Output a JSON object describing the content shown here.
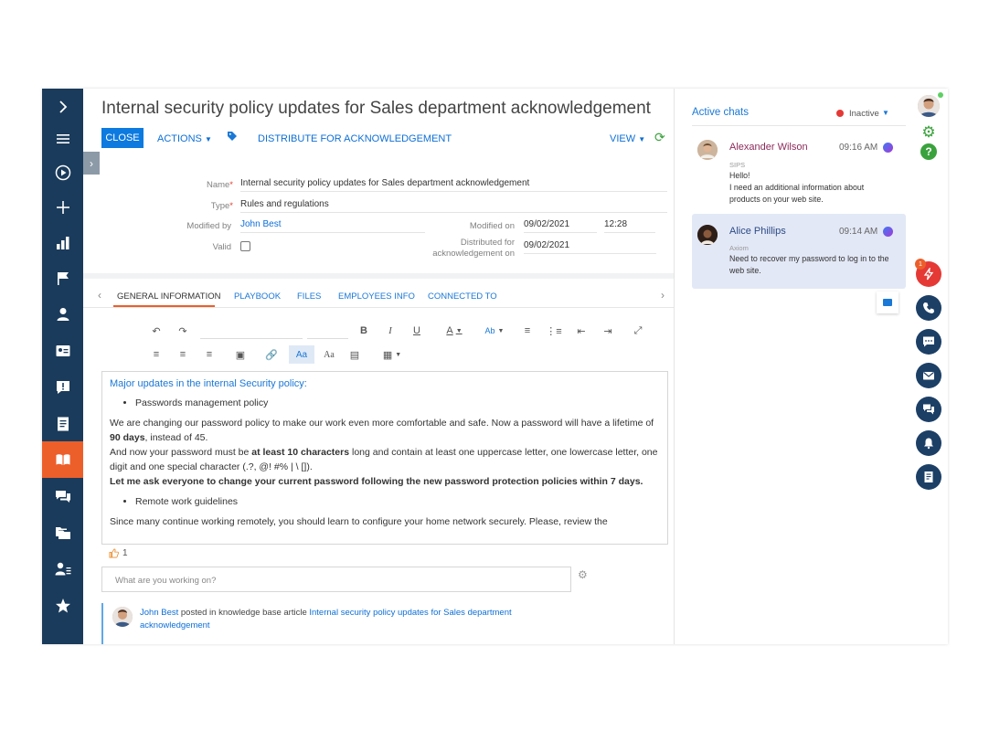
{
  "page": {
    "title": "Internal security policy updates for Sales department acknowledgement"
  },
  "toolbar": {
    "close": "CLOSE",
    "actions": "ACTIONS",
    "distribute": "DISTRIBUTE FOR ACKNOWLEDGEMENT",
    "view": "VIEW"
  },
  "fields": {
    "name_label": "Name",
    "name_value": "Internal security policy updates for Sales department acknowledgement",
    "type_label": "Type",
    "type_value": "Rules and regulations",
    "modified_by_label": "Modified by",
    "modified_by_value": "John Best",
    "valid_label": "Valid",
    "modified_on_label": "Modified on",
    "modified_on_date": "09/02/2021",
    "modified_on_time": "12:28",
    "distributed_label_1": "Distributed for",
    "distributed_label_2": "acknowledgement on",
    "distributed_value": "09/02/2021"
  },
  "tabs": [
    "GENERAL INFORMATION",
    "PLAYBOOK",
    "FILES",
    "EMPLOYEES INFO",
    "CONNECTED TO"
  ],
  "editor": {
    "heading": "Major updates in the internal Security policy:",
    "bullet1": "Passwords management policy",
    "p1_a": "We are changing our password policy to make our work even more comfortable and safe. Now a password will have a lifetime of ",
    "p1_b": "90 days",
    "p1_c": ", instead of 45.",
    "p2_a": "And now your password must be ",
    "p2_b": "at least 10 characters",
    "p2_c": " long and contain at least one uppercase letter, one lowercase letter, one digit and one special character (.?, @! #% | \\ []).",
    "p3": "Let me ask everyone to change your current password following the new password protection policies within 7 days.",
    "bullet2": "Remote work guidelines",
    "p4": "Since many continue working remotely, you should learn to configure your home network securely.  Please, review the"
  },
  "likes": "1",
  "post_placeholder": "What are you working on?",
  "feed": {
    "author": "John Best",
    "action": " posted in knowledge base article ",
    "article": "Internal security policy updates for Sales department acknowledgement"
  },
  "chats": {
    "title": "Active chats",
    "status": "Inactive",
    "items": [
      {
        "name": "Alexander Wilson",
        "time": "09:16 AM",
        "sub": "SIPS",
        "msg1": "Hello!",
        "msg2": "I need an additional information about products on your web site."
      },
      {
        "name": "Alice Phillips",
        "time": "09:14 AM",
        "sub": "Axiom",
        "msg1": "Need to recover my password to log in to the web site.",
        "msg2": ""
      }
    ]
  },
  "rightbar": {
    "badge": "1"
  },
  "colors": {
    "nav_bg": "#1a3b5b",
    "accent_orange": "#ec5f2a",
    "link_blue": "#0d6fd6",
    "close_button": "#0d7ae0",
    "green": "#3aa23c"
  }
}
